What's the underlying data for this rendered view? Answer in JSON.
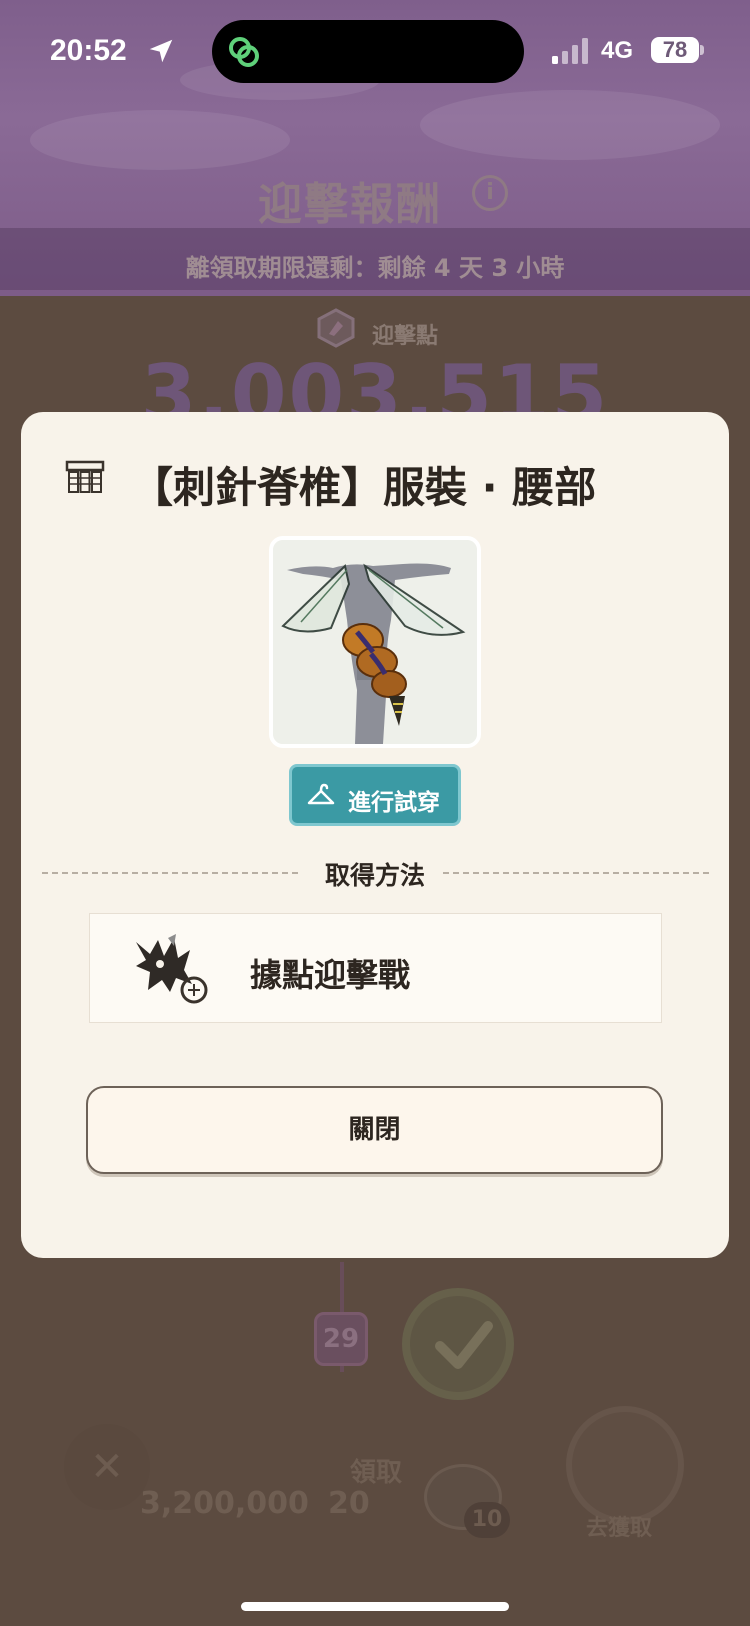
{
  "status_bar": {
    "time": "20:52",
    "network": "4G",
    "battery": "78"
  },
  "background": {
    "title": "迎擊報酬",
    "deadline": "離領取期限還剩：剩餘 4 天 3 小時",
    "points_label": "迎擊點",
    "points_value": "3,003,515",
    "level": "29",
    "claim_label": "領取",
    "amount_left": "3,200,000",
    "amount_right": "20",
    "coin_count": "10",
    "switch_label": "去獲取"
  },
  "modal": {
    "title": "【刺針脊椎】服裝 · 腰部",
    "try_on_label": "進行試穿",
    "acquire_method_label": "取得方法",
    "method": "據點迎擊戰",
    "close_label": "關閉"
  },
  "colors": {
    "accent_teal": "#3b9aa4",
    "modal_bg": "#f8f3ea",
    "header_purple": "#7f5f8c",
    "overlay_brown": "#5c4b40"
  },
  "icons": [
    "location-arrow-icon",
    "app-link-icon",
    "signal-icon",
    "battery-icon",
    "info-icon",
    "points-hex-icon",
    "outfit-slot-icon",
    "hanger-icon",
    "monster-icon",
    "check-icon",
    "close-x-icon"
  ]
}
